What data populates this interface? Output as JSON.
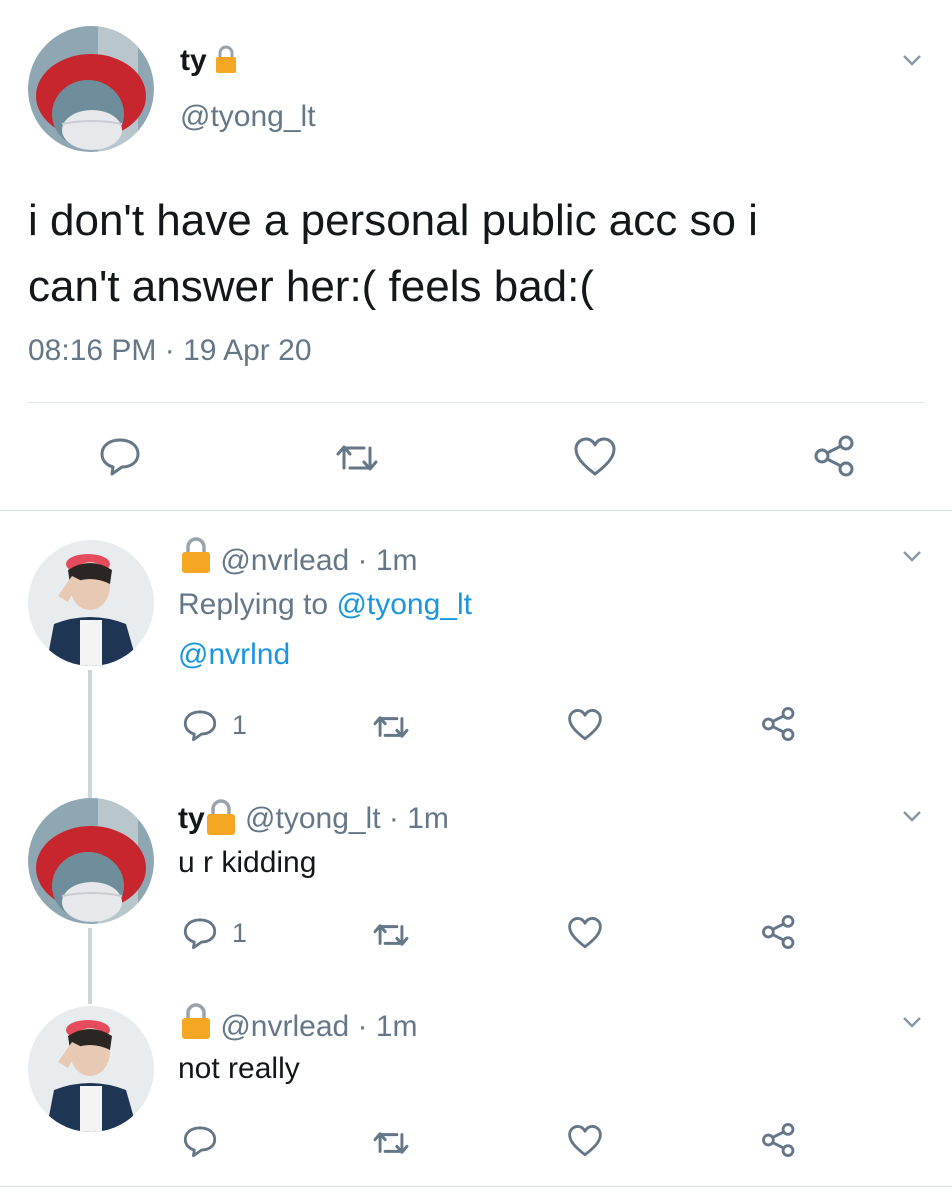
{
  "main_tweet": {
    "display_name": "ty",
    "handle": "@tyong_lt",
    "text_line1": "i don't have a personal public acc so i",
    "text_line2": "can't answer her:( feels bad:(",
    "timestamp": "08:16 PM · 19 Apr 20"
  },
  "replies": [
    {
      "display_name": "",
      "handle": "@nvrlead",
      "time": " · 1m",
      "replying_prefix": "Replying to ",
      "replying_to": "@tyong_lt",
      "text": "@nvrlnd",
      "reply_count": "1"
    },
    {
      "display_name": "ty",
      "handle": "@tyong_lt",
      "time": " · 1m",
      "text": "u r kidding",
      "reply_count": "1"
    },
    {
      "display_name": "",
      "handle": "@nvrlead",
      "time": " · 1m",
      "text": "not really",
      "reply_count": ""
    }
  ],
  "colors": {
    "text": "#14171a",
    "secondary": "#657786",
    "link": "#1b95e0",
    "divider": "#e1e8ed",
    "lock": "#f5a623"
  },
  "icons": [
    "lock-icon",
    "chevron-down-icon",
    "reply-icon",
    "retweet-icon",
    "like-icon",
    "share-icon"
  ]
}
